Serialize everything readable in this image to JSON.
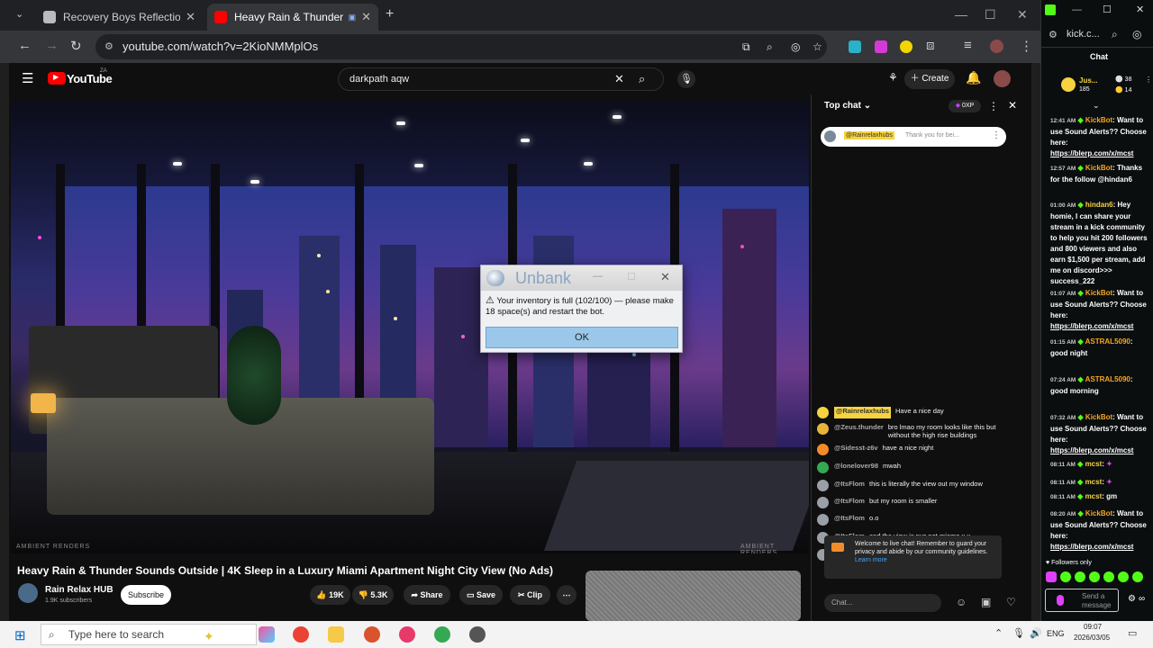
{
  "browser": {
    "tabs": [
      {
        "title": "Recovery Boys Reflection",
        "active": false
      },
      {
        "title": "Heavy Rain & Thunder Sou",
        "active": true
      }
    ],
    "url": "youtube.com/watch?v=2KioNMMplOs"
  },
  "youtube": {
    "logo": "YouTube",
    "country": "ZA",
    "search_value": "darkpath aqw",
    "create_label": "Create",
    "video": {
      "watermark_left": "AMBIENT RENDERS",
      "watermark_right": "AMBIENT RENDERS"
    },
    "title": "Heavy Rain & Thunder Sounds Outside | 4K Sleep in a Luxury Miami Apartment Night City View (No Ads)",
    "channel": {
      "name": "Rain Relax HUB",
      "subscribers": "1.9K subscribers",
      "subscribe_label": "Subscribe"
    },
    "actions": {
      "likes": "19K",
      "dislikes": "5.3K",
      "share": "Share",
      "save": "Save",
      "clip": "Clip"
    }
  },
  "dialog": {
    "title": "Unbank",
    "message": "Your inventory is full (102/100) — please make 18 space(s) and restart the bot.",
    "ok_label": "OK"
  },
  "ytchat": {
    "header": "Top chat",
    "xp": "0XP",
    "pinned": {
      "author": "@Rainrelaxhubs",
      "text": "Thank you for bei..."
    },
    "messages": [
      {
        "author": "@Rainrelaxhubs",
        "text": "Have a nice day",
        "color": "#f6d33f"
      },
      {
        "author": "@Zeus.thunder",
        "text": "bro lmao my room looks like this but without the high rise buildings",
        "color": "#e9b43a"
      },
      {
        "author": "@Sidesst-z6v",
        "text": "have a nice night",
        "color": "#f28c28"
      },
      {
        "author": "@lonelover98",
        "text": "mwah",
        "color": "#34a853"
      },
      {
        "author": "@ItsFlom",
        "text": "this is literally the view out my window",
        "color": "#9aa0a6"
      },
      {
        "author": "@ItsFlom",
        "text": "but my room is smaller",
        "color": "#9aa0a6"
      },
      {
        "author": "@ItsFlom",
        "text": "o.o",
        "color": "#9aa0a6"
      },
      {
        "author": "@ItsFlom",
        "text": "and the view is nyc not miama x.x",
        "color": "#9aa0a6"
      },
      {
        "author": "@ItsFlom",
        "text": "miami*",
        "color": "#9aa0a6"
      }
    ],
    "welcome": "Welcome to live chat! Remember to guard your privacy and abide by our community guidelines.",
    "learn_more": "Learn more",
    "input_placeholder": "Chat..."
  },
  "kick": {
    "url": "kick.c...",
    "chat_title": "Chat",
    "user": "Jus...",
    "stats": [
      "38",
      "185",
      "14"
    ],
    "messages": [
      {
        "time": "12:41 AM",
        "user": "KickBot",
        "text": "Want to use Sound Alerts?? Choose here:",
        "link": "https://blerp.com/x/mcst"
      },
      {
        "time": "12:57 AM",
        "user": "KickBot",
        "text": "Thanks for the follow @hindan6",
        "link": ""
      },
      {
        "time": "01:00 AM",
        "user": "hindan6",
        "text": "Hey homie, I can share your stream in a kick community to help you hit 200 followers and 800 viewers and also earn $1,500 per stream, add me on discord>>> success_222",
        "link": ""
      },
      {
        "time": "01:07 AM",
        "user": "KickBot",
        "text": "Want to use Sound Alerts?? Choose here:",
        "link": "https://blerp.com/x/mcst"
      },
      {
        "time": "01:15 AM",
        "user": "ASTRAL5090",
        "text": "good night",
        "link": ""
      },
      {
        "time": "07:24 AM",
        "user": "ASTRAL5090",
        "text": "good morning",
        "link": ""
      },
      {
        "time": "07:32 AM",
        "user": "KickBot",
        "text": "Want to use Sound Alerts?? Choose here:",
        "link": "https://blerp.com/x/mcst"
      },
      {
        "time": "08:11 AM",
        "user": "mcst",
        "text": "",
        "link": ""
      },
      {
        "time": "08:11 AM",
        "user": "mcst",
        "text": "",
        "link": ""
      },
      {
        "time": "08:11 AM",
        "user": "mcst",
        "text": "gm",
        "link": ""
      },
      {
        "time": "08:20 AM",
        "user": "KickBot",
        "text": "Want to use Sound Alerts?? Choose here:",
        "link": "https://blerp.com/x/mcst"
      }
    ],
    "followers_only": "Followers only",
    "send_placeholder": "Send a message"
  },
  "taskbar": {
    "search_placeholder": "Type here to search",
    "lang": "ENG",
    "time": "09:07",
    "date": "2026/03/05"
  }
}
